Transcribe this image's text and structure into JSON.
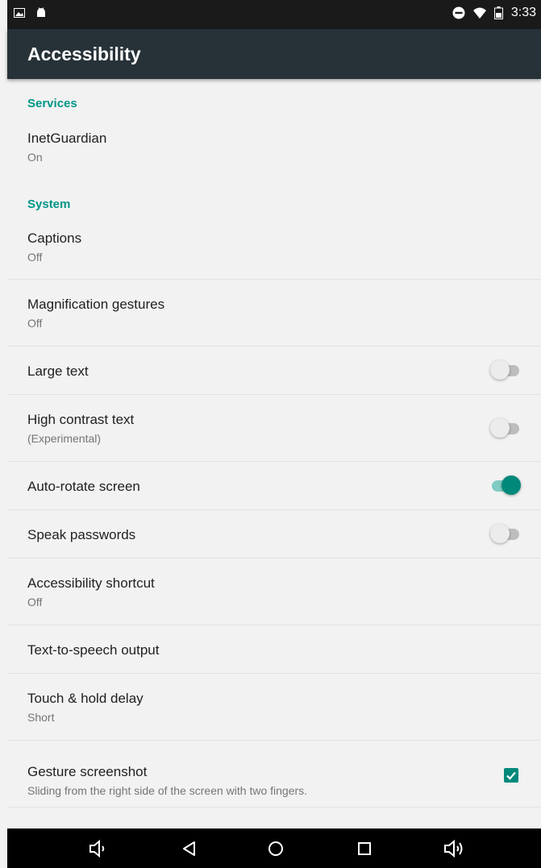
{
  "status_bar": {
    "time": "3:33",
    "left_icons": [
      "image-icon",
      "android-icon"
    ],
    "right_icons": [
      "do-not-disturb-icon",
      "wifi-icon",
      "battery-icon"
    ]
  },
  "app_bar": {
    "title": "Accessibility"
  },
  "sections": {
    "services": "Services",
    "system": "System"
  },
  "items": {
    "inet_guardian": {
      "title": "InetGuardian",
      "summary": "On"
    },
    "captions": {
      "title": "Captions",
      "summary": "Off"
    },
    "magnification": {
      "title": "Magnification gestures",
      "summary": "Off"
    },
    "large_text": {
      "title": "Large text",
      "switch_on": false
    },
    "high_contrast": {
      "title": "High contrast text",
      "summary": "(Experimental)",
      "switch_on": false
    },
    "auto_rotate": {
      "title": "Auto-rotate screen",
      "switch_on": true
    },
    "speak_passwords": {
      "title": "Speak passwords",
      "switch_on": false
    },
    "accessibility_shortcut": {
      "title": "Accessibility shortcut",
      "summary": "Off"
    },
    "tts_output": {
      "title": "Text-to-speech output"
    },
    "touch_hold": {
      "title": "Touch & hold delay",
      "summary": "Short"
    },
    "gesture_screenshot": {
      "title": "Gesture screenshot",
      "summary": "Sliding from the right side of the screen with two fingers.",
      "checked": true
    }
  },
  "nav_bar": {
    "buttons": [
      "volume-down-icon",
      "back-icon",
      "home-icon",
      "recents-icon",
      "volume-up-icon"
    ]
  },
  "colors": {
    "accent": "#009688",
    "switch_on": "#00897b",
    "app_bar": "#263238",
    "background": "#f2f2f2"
  }
}
